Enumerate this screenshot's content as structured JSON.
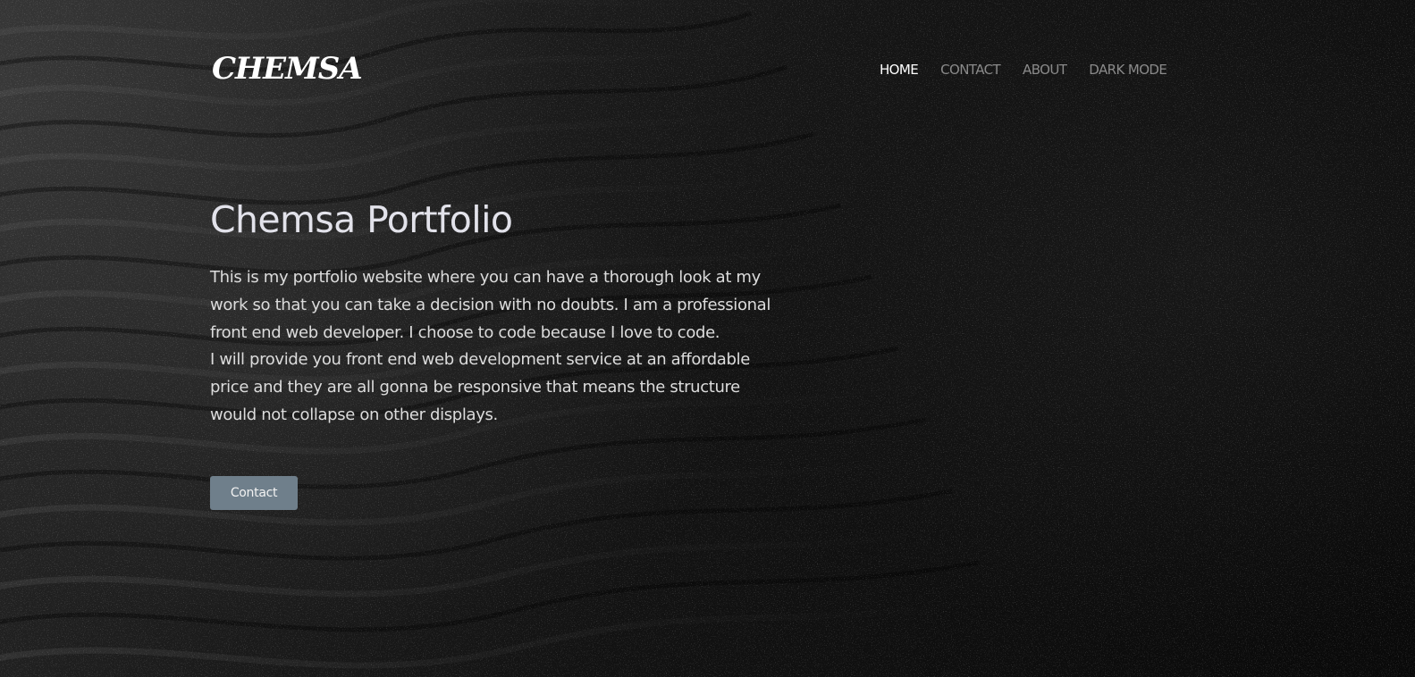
{
  "brand": {
    "logo_text": "CHEMSA"
  },
  "nav": {
    "items": [
      {
        "label": "HOME",
        "active": true
      },
      {
        "label": "CONTACT",
        "active": false
      },
      {
        "label": "ABOUT",
        "active": false
      },
      {
        "label": "DARK MODE",
        "active": false
      }
    ]
  },
  "hero": {
    "title": "Chemsa Portfolio",
    "paragraph_1": "This is my portfolio website where you can have a thorough look at my work so that you can take a decision with no doubts. I am a professional front end web developer. I choose to code because I love to code.",
    "paragraph_2": "I will provide you front end web development service at an affordable price and they are all gonna be responsive that means the structure would not collapse on other displays.",
    "button_label": "Contact"
  },
  "theme": {
    "background": "#0c0c0c",
    "text": "#e2e2ea",
    "nav_inactive": "#8a8a8a",
    "nav_active": "#ffffff",
    "button_bg": "#6f7f8b"
  }
}
